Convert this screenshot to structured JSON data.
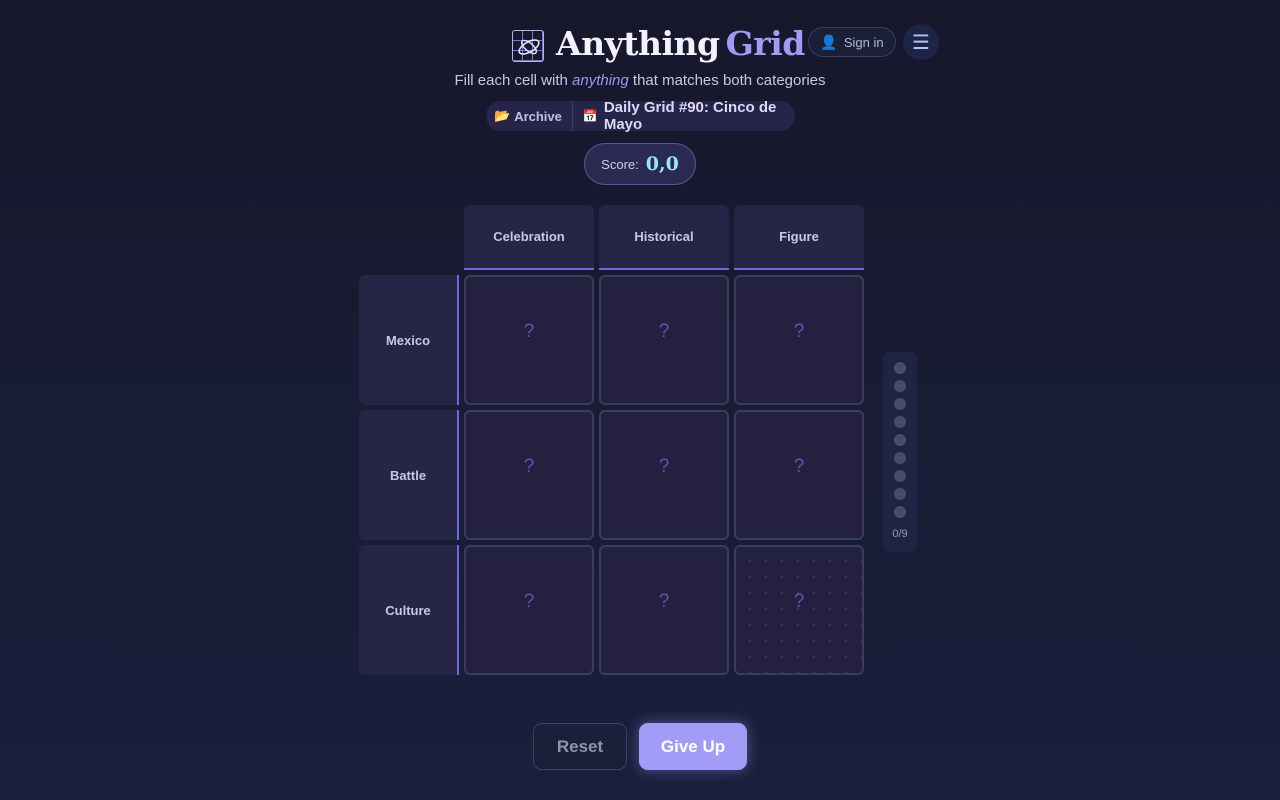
{
  "header": {
    "title_part1": "Anything",
    "title_part2": "Grid",
    "logo_icon": "grid-knot-logo",
    "signin_icon": "person-icon",
    "signin_label": "Sign in",
    "menu_icon": "☰"
  },
  "subtitle": {
    "before": "Fill each cell with ",
    "emphasis": "anything",
    "after": " that matches both categories"
  },
  "nav": {
    "archive_icon": "📂",
    "archive_label": "Archive",
    "calendar_icon": "📅",
    "daily_label": "Daily Grid #90: Cinco de Mayo"
  },
  "score": {
    "label": "Score:",
    "value": "0,0"
  },
  "grid": {
    "columns": [
      "Celebration",
      "Historical",
      "Figure"
    ],
    "rows": [
      "Mexico",
      "Battle",
      "Culture"
    ],
    "cells": [
      [
        "?",
        "?",
        "?"
      ],
      [
        "?",
        "?",
        "?"
      ],
      [
        "?",
        "?",
        "?"
      ]
    ]
  },
  "progress": {
    "filled": 0,
    "total": 9,
    "label": "0/9"
  },
  "buttons": {
    "reset": "Reset",
    "give_up": "Give Up"
  },
  "colors": {
    "accent": "#a39cf6",
    "accent_line": "#6f66e0",
    "score_value": "#9ee3f2",
    "background": "#17172c"
  }
}
